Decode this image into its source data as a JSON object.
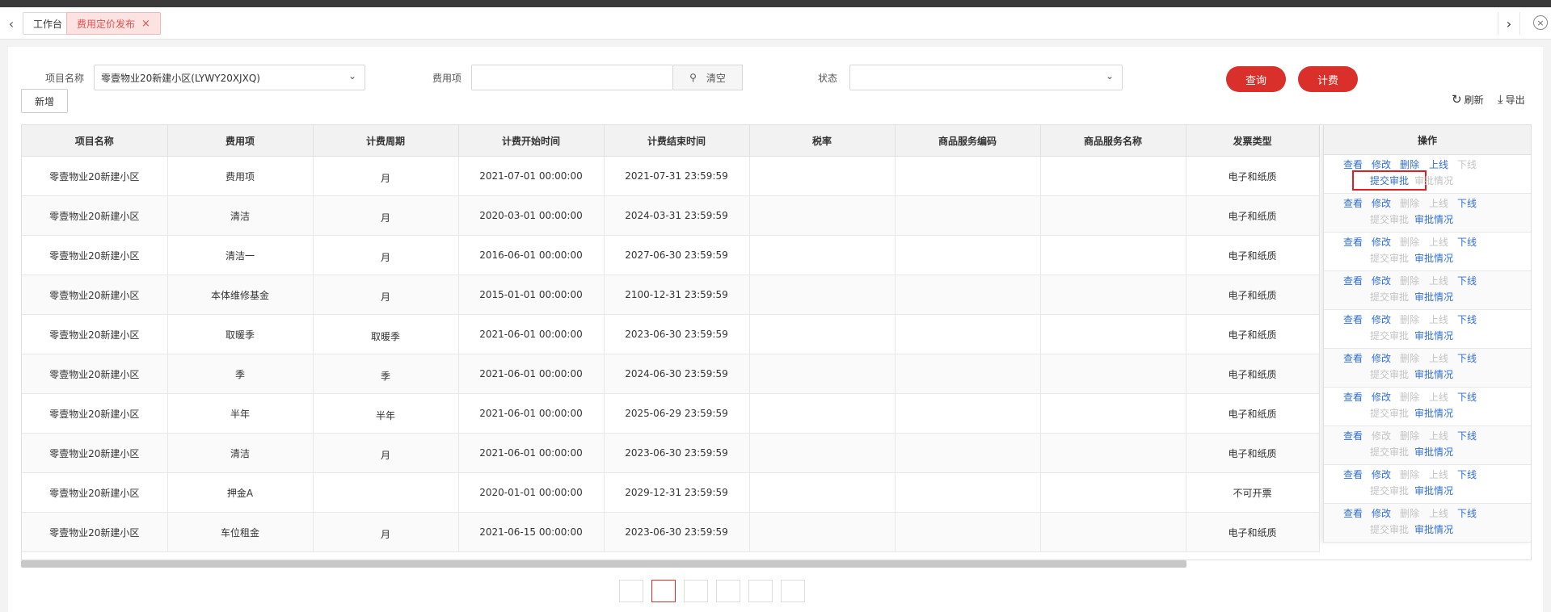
{
  "tabs": {
    "items": [
      {
        "label": "工作台"
      },
      {
        "label": "费用定价发布",
        "close": "×"
      }
    ],
    "prev": "‹",
    "next": "›",
    "close_all": "×"
  },
  "filters": {
    "project_label": "项目名称",
    "project_value": "零壹物业20新建小区(LYWY20XJXQ)",
    "fee_label": "费用项",
    "fee_value": "",
    "clear_label": "清空",
    "status_label": "状态",
    "status_value": "",
    "query_label": "查询",
    "charge_label": "计费"
  },
  "toolbar": {
    "add_label": "新增",
    "refresh_label": "刷新",
    "export_label": "导出"
  },
  "table": {
    "headers": [
      "项目名称",
      "费用项",
      "计费周期",
      "计费开始时间",
      "计费结束时间",
      "税率",
      "商品服务编码",
      "商品服务名称",
      "发票类型"
    ],
    "ops_header": "操作",
    "rows": [
      {
        "project": "零壹物业20新建小区",
        "fee": "费用项",
        "cycle": "月",
        "start": "2021-07-01 00:00:00",
        "end": "2021-07-31 23:59:59",
        "tax": "",
        "code": "",
        "name": "",
        "invoice": "电子和纸质"
      },
      {
        "project": "零壹物业20新建小区",
        "fee": "清洁",
        "cycle": "月",
        "start": "2020-03-01 00:00:00",
        "end": "2024-03-31 23:59:59",
        "tax": "",
        "code": "",
        "name": "",
        "invoice": "电子和纸质"
      },
      {
        "project": "零壹物业20新建小区",
        "fee": "清洁一",
        "cycle": "月",
        "start": "2016-06-01 00:00:00",
        "end": "2027-06-30 23:59:59",
        "tax": "",
        "code": "",
        "name": "",
        "invoice": "电子和纸质"
      },
      {
        "project": "零壹物业20新建小区",
        "fee": "本体维修基金",
        "cycle": "月",
        "start": "2015-01-01 00:00:00",
        "end": "2100-12-31 23:59:59",
        "tax": "",
        "code": "",
        "name": "",
        "invoice": "电子和纸质"
      },
      {
        "project": "零壹物业20新建小区",
        "fee": "取暖季",
        "cycle": "取暖季",
        "start": "2021-06-01 00:00:00",
        "end": "2023-06-30 23:59:59",
        "tax": "",
        "code": "",
        "name": "",
        "invoice": "电子和纸质"
      },
      {
        "project": "零壹物业20新建小区",
        "fee": "季",
        "cycle": "季",
        "start": "2021-06-01 00:00:00",
        "end": "2024-06-30 23:59:59",
        "tax": "",
        "code": "",
        "name": "",
        "invoice": "电子和纸质"
      },
      {
        "project": "零壹物业20新建小区",
        "fee": "半年",
        "cycle": "半年",
        "start": "2021-06-01 00:00:00",
        "end": "2025-06-29 23:59:59",
        "tax": "",
        "code": "",
        "name": "",
        "invoice": "电子和纸质"
      },
      {
        "project": "零壹物业20新建小区",
        "fee": "清洁",
        "cycle": "月",
        "start": "2021-06-01 00:00:00",
        "end": "2023-06-30 23:59:59",
        "tax": "",
        "code": "",
        "name": "",
        "invoice": "电子和纸质"
      },
      {
        "project": "零壹物业20新建小区",
        "fee": "押金A",
        "cycle": "",
        "start": "2020-01-01 00:00:00",
        "end": "2029-12-31 23:59:59",
        "tax": "",
        "code": "",
        "name": "",
        "invoice": "不可开票"
      },
      {
        "project": "零壹物业20新建小区",
        "fee": "车位租金",
        "cycle": "月",
        "start": "2021-06-15 00:00:00",
        "end": "2023-06-30 23:59:59",
        "tax": "",
        "code": "",
        "name": "",
        "invoice": "电子和纸质"
      }
    ],
    "ops_labels": {
      "view": "查看",
      "edit": "修改",
      "delete": "删除",
      "online": "上线",
      "offline": "下线",
      "submit": "提交审批",
      "approval": "审批情况"
    }
  },
  "colors": {
    "accent_red": "#d9302b",
    "link_blue": "#2f6fd0",
    "disabled_gray": "#c3c3c3",
    "highlight_box": "#e02020"
  }
}
